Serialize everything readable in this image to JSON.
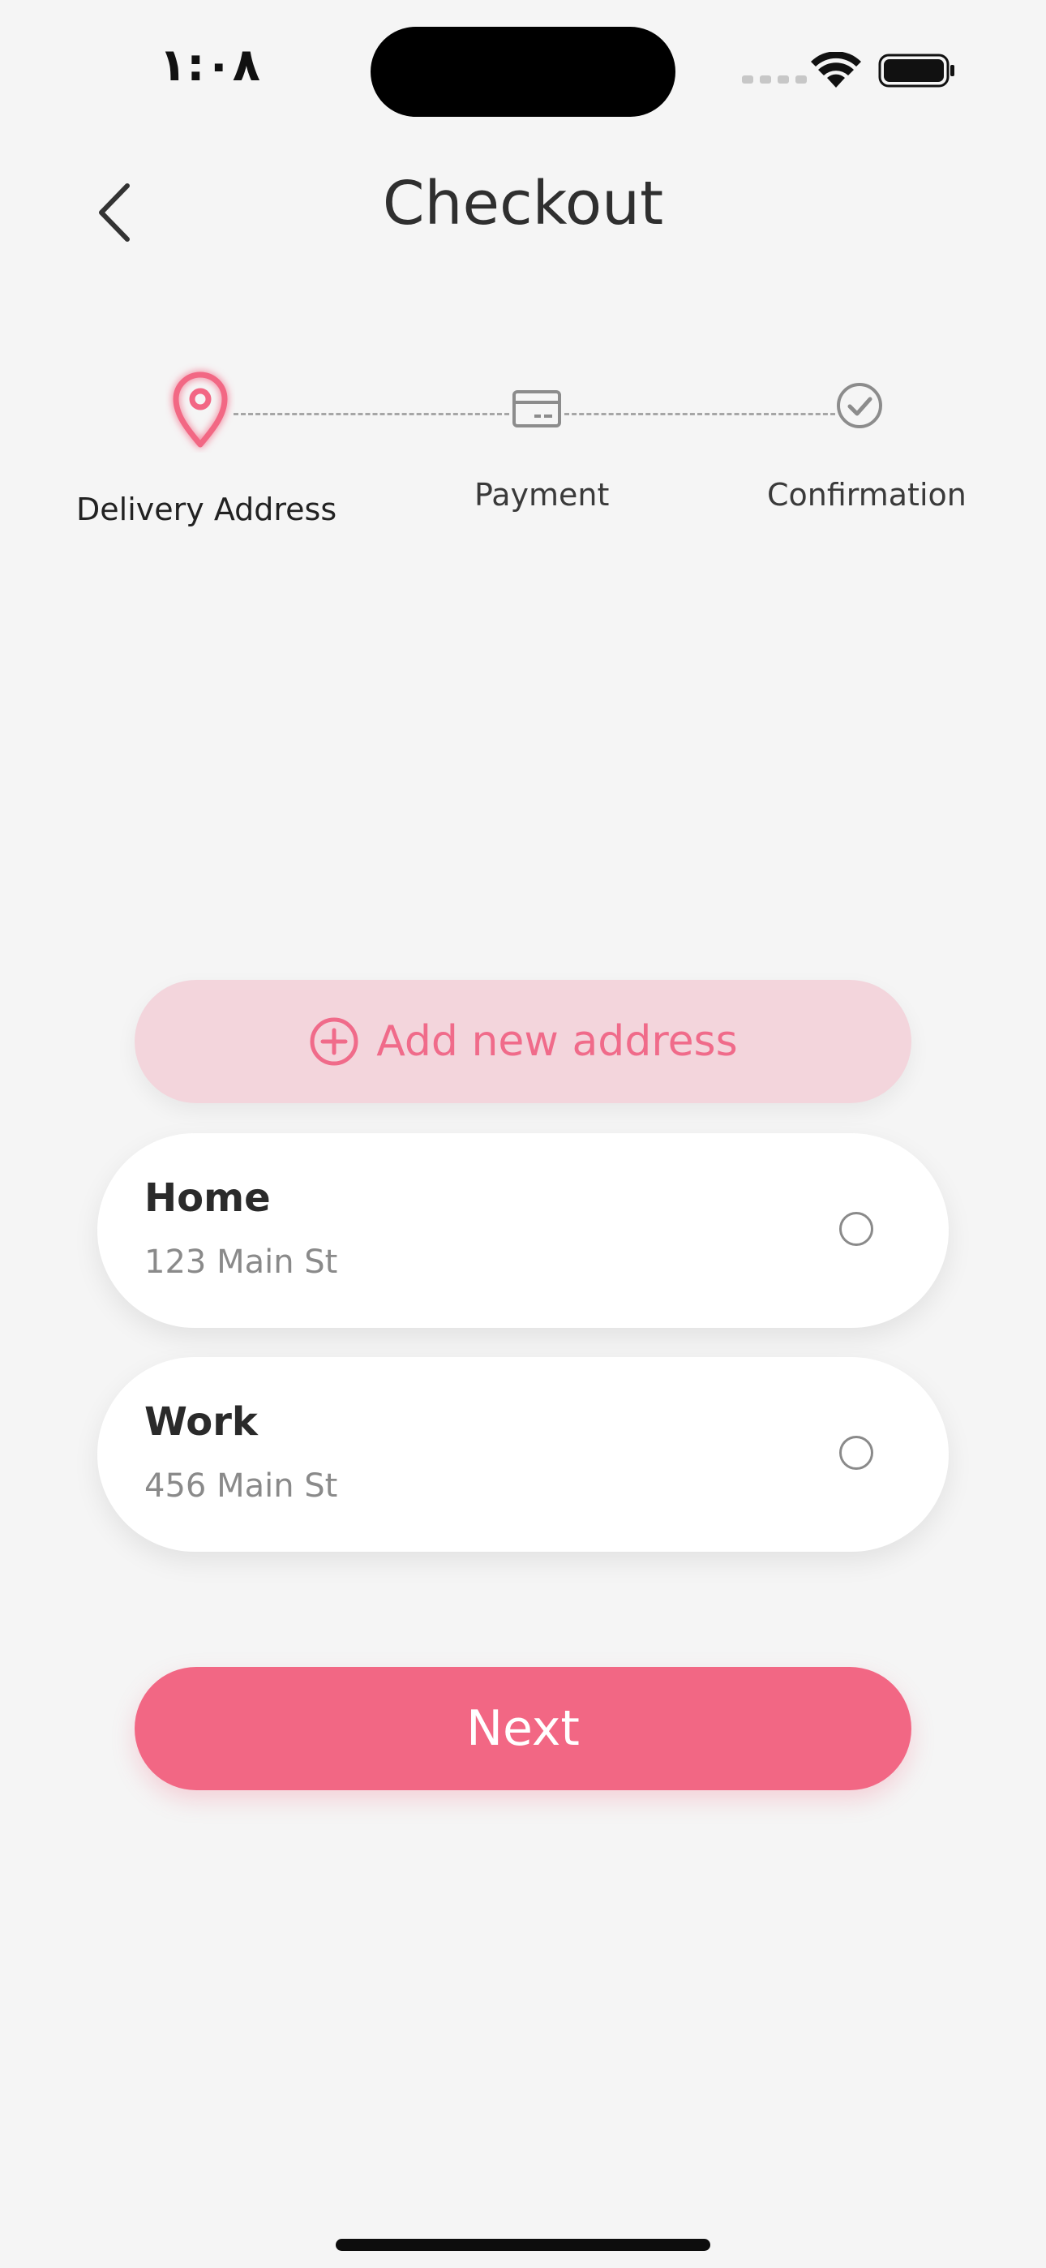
{
  "status_bar": {
    "time": "١:٠٨",
    "wifi_icon": "wifi-icon",
    "battery_icon": "battery-icon"
  },
  "header": {
    "title": "Checkout",
    "back_icon": "chevron-left-icon"
  },
  "stepper": {
    "steps": [
      {
        "label": "Delivery Address",
        "icon": "location-pin-icon",
        "active": true
      },
      {
        "label": "Payment",
        "icon": "credit-card-icon",
        "active": false
      },
      {
        "label": "Confirmation",
        "icon": "check-circle-icon",
        "active": false
      }
    ]
  },
  "actions": {
    "add_address_label": "Add new address",
    "add_icon": "plus-circle-icon",
    "next_label": "Next"
  },
  "addresses": [
    {
      "name": "Home",
      "line": "123 Main St",
      "selected": false
    },
    {
      "name": "Work",
      "line": "456 Main St",
      "selected": false
    }
  ],
  "colors": {
    "accent": "#f26784",
    "accent_soft": "#f3d5dc",
    "background": "#f5f5f5",
    "card": "#ffffff",
    "muted_text": "#8a8a8a"
  }
}
